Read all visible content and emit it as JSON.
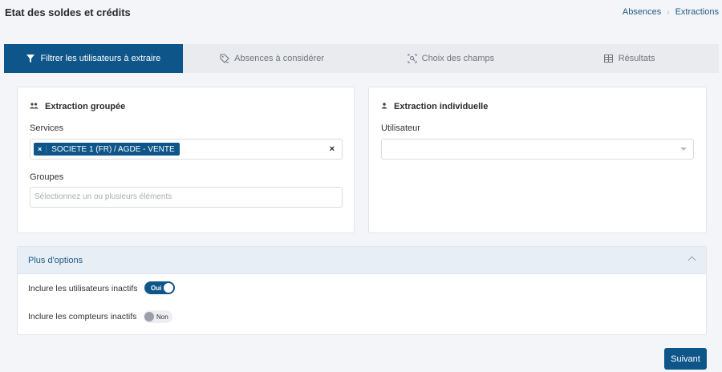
{
  "header": {
    "title": "Etat des soldes et crédits",
    "breadcrumb": [
      "Absences",
      "Extractions"
    ]
  },
  "tabs": [
    {
      "label": "Filtrer les utilisateurs à extraire",
      "icon": "filter-icon",
      "active": true
    },
    {
      "label": "Absences à considérer",
      "icon": "tag-icon",
      "active": false
    },
    {
      "label": "Choix des champs",
      "icon": "field-select-icon",
      "active": false
    },
    {
      "label": "Résultats",
      "icon": "table-icon",
      "active": false
    }
  ],
  "group_extraction": {
    "title": "Extraction groupée",
    "services_label": "Services",
    "services_selected": [
      "SOCIETE 1 (FR) / AGDE - VENTE"
    ],
    "groups_label": "Groupes",
    "groups_placeholder": "Sélectionnez un ou plusieurs éléments"
  },
  "individual_extraction": {
    "title": "Extraction individuelle",
    "user_label": "Utilisateur",
    "user_value": ""
  },
  "options": {
    "title": "Plus d'options",
    "inactive_users_label": "Inclure les utilisateurs inactifs",
    "inactive_users_state": "Oui",
    "inactive_counters_label": "Inclure les compteurs inactifs",
    "inactive_counters_state": "Non"
  },
  "footer": {
    "next_label": "Suivant"
  },
  "colors": {
    "primary": "#0e5589",
    "background": "#f4f5f8"
  }
}
